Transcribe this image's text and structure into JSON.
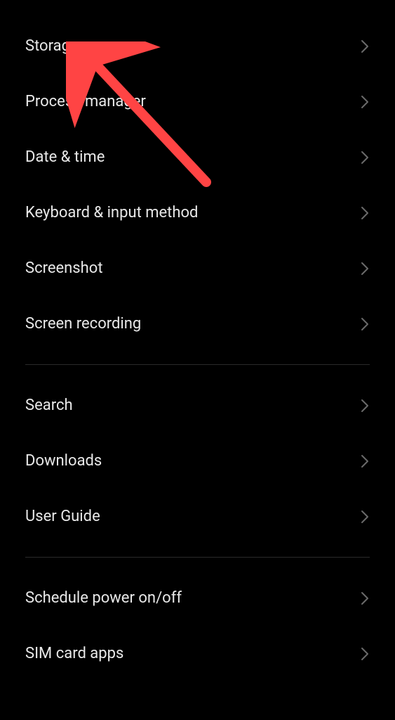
{
  "groups": [
    {
      "items": [
        {
          "id": "storage",
          "label": "Storage"
        },
        {
          "id": "process-manager",
          "label": "Process manager"
        },
        {
          "id": "date-time",
          "label": "Date & time"
        },
        {
          "id": "keyboard-input",
          "label": "Keyboard & input method"
        },
        {
          "id": "screenshot",
          "label": "Screenshot"
        },
        {
          "id": "screen-recording",
          "label": "Screen recording"
        }
      ]
    },
    {
      "items": [
        {
          "id": "search",
          "label": "Search"
        },
        {
          "id": "downloads",
          "label": "Downloads"
        },
        {
          "id": "user-guide",
          "label": "User Guide"
        }
      ]
    },
    {
      "items": [
        {
          "id": "schedule-power",
          "label": "Schedule power on/off"
        },
        {
          "id": "sim-card-apps",
          "label": "SIM card apps"
        }
      ]
    }
  ]
}
